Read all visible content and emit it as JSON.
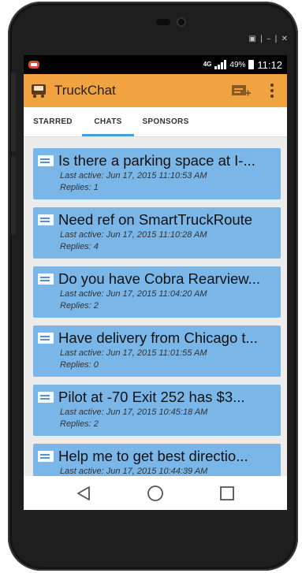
{
  "statusbar": {
    "network": "4G",
    "battery": "49%",
    "time": "11:12"
  },
  "appbar": {
    "title": "TruckChat",
    "logo_icon": "truck-icon",
    "compose_icon": "new-chat-icon",
    "overflow_icon": "overflow-menu-icon",
    "color": "#f2a341"
  },
  "tabs": [
    {
      "label": "STARRED",
      "active": false
    },
    {
      "label": "CHATS",
      "active": true
    },
    {
      "label": "SPONSORS",
      "active": false
    }
  ],
  "chats": [
    {
      "title": "Is there a parking space at I-...",
      "last_active": "Last active: Jun 17, 2015 11:10:53 AM",
      "replies": "Replies: 1"
    },
    {
      "title": "Need ref on SmartTruckRoute",
      "last_active": "Last active: Jun 17, 2015 11:10:28 AM",
      "replies": "Replies: 4"
    },
    {
      "title": "Do you have Cobra Rearview...",
      "last_active": "Last active: Jun 17, 2015 11:04:20 AM",
      "replies": "Replies: 2"
    },
    {
      "title": "Have delivery from Chicago t...",
      "last_active": "Last active: Jun 17, 2015 11:01:55 AM",
      "replies": "Replies: 0"
    },
    {
      "title": "Pilot at -70  Exit 252 has $3...",
      "last_active": "Last active: Jun 17, 2015 10:45:18 AM",
      "replies": "Replies: 2"
    },
    {
      "title": "Help me to get best directio...",
      "last_active": "Last active: Jun 17, 2015 10:44:39 AM",
      "replies": ""
    }
  ],
  "colors": {
    "card": "#7ab6e8",
    "tab_indicator": "#4a9fd8"
  }
}
